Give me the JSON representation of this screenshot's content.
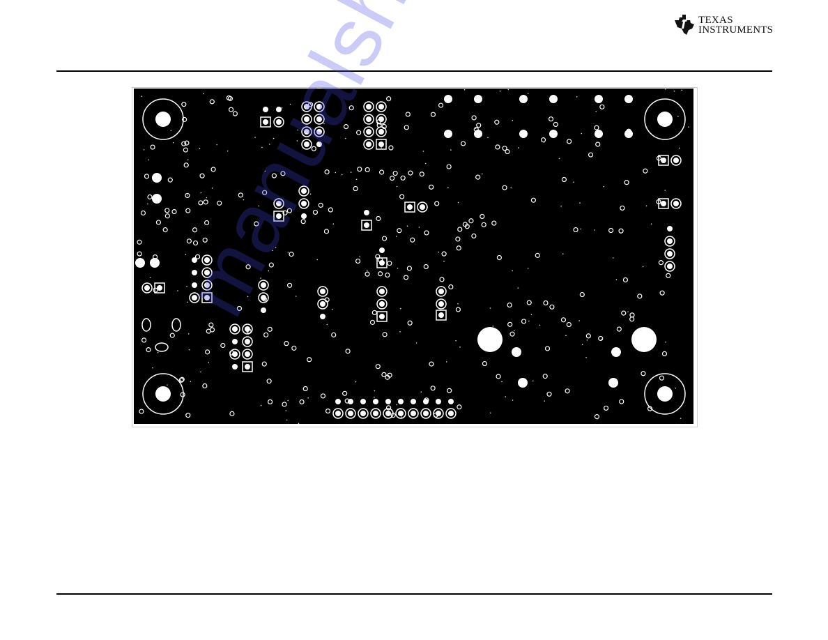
{
  "header": {
    "brand_line1": "Texas",
    "brand_line2": "Instruments",
    "logo_icon": "ti-logo-icon"
  },
  "figure": {
    "description": "PCB bottom layer layout",
    "background_color": "#000000",
    "copper_color": "#ffffff"
  },
  "watermark": {
    "text": "manualshive.com",
    "color": "#4646e6"
  }
}
